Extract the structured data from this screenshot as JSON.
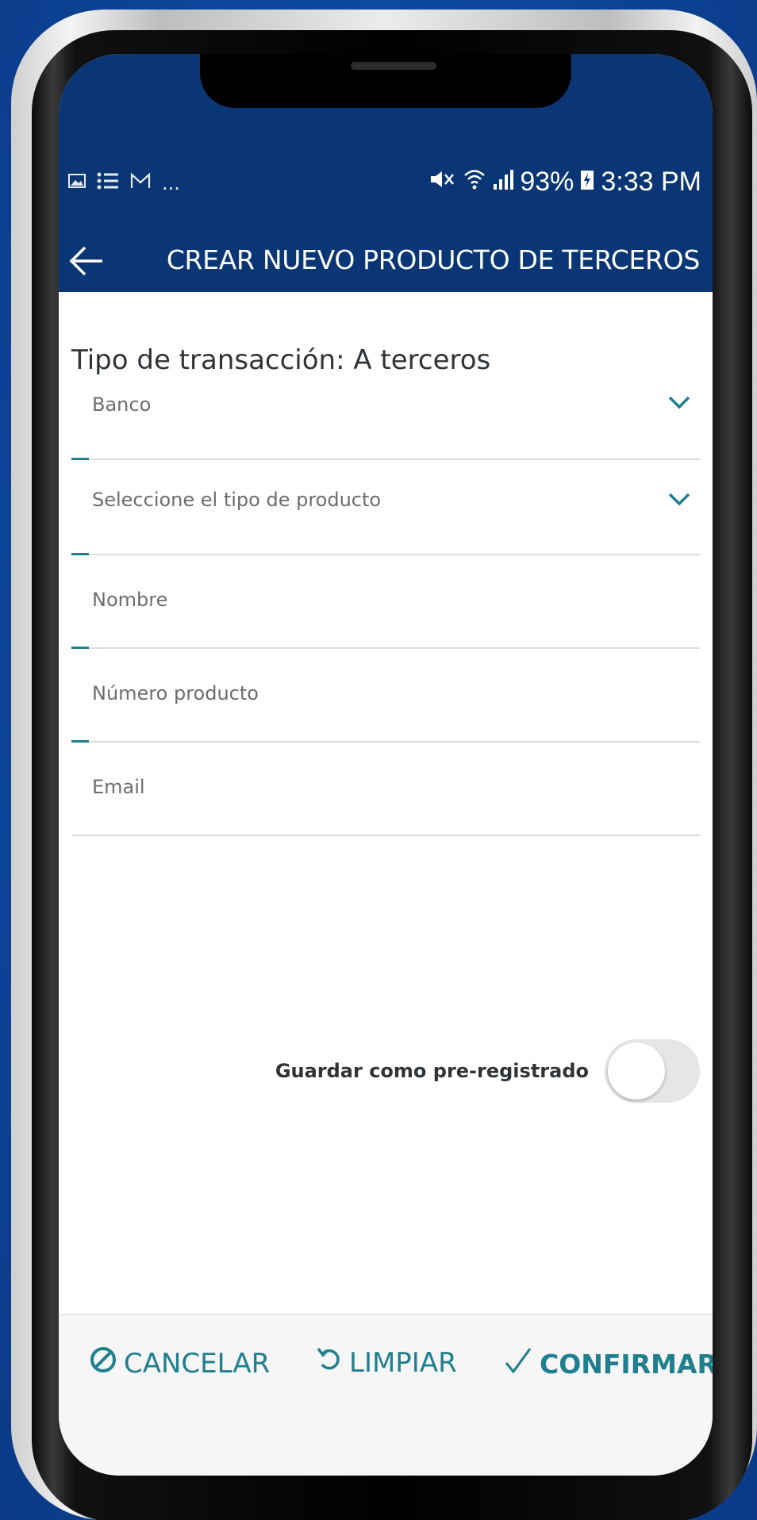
{
  "status_bar": {
    "left_icons": [
      "image-icon",
      "list-icon",
      "mail-icon"
    ],
    "more": "...",
    "battery": "93%",
    "time": "3:33 PM"
  },
  "toolbar": {
    "title": "CREAR NUEVO PRODUCTO DE TERCEROS"
  },
  "form": {
    "section_title": "Tipo de transacción: A terceros",
    "fields": [
      {
        "label": "Banco",
        "type": "select"
      },
      {
        "label": "Seleccione el tipo de producto",
        "type": "select"
      },
      {
        "label": "Nombre",
        "type": "text"
      },
      {
        "label": "Número producto",
        "type": "text"
      },
      {
        "label": "Email",
        "type": "text"
      }
    ],
    "toggle": {
      "label": "Guardar como pre-registrado",
      "checked": false
    }
  },
  "actions": {
    "cancel": "CANCELAR",
    "clear": "LIMPIAR",
    "confirm": "CONFIRMAR"
  },
  "colors": {
    "header": "#0a3675",
    "accent": "#1f7f8e",
    "background": "#0f4ca6"
  }
}
